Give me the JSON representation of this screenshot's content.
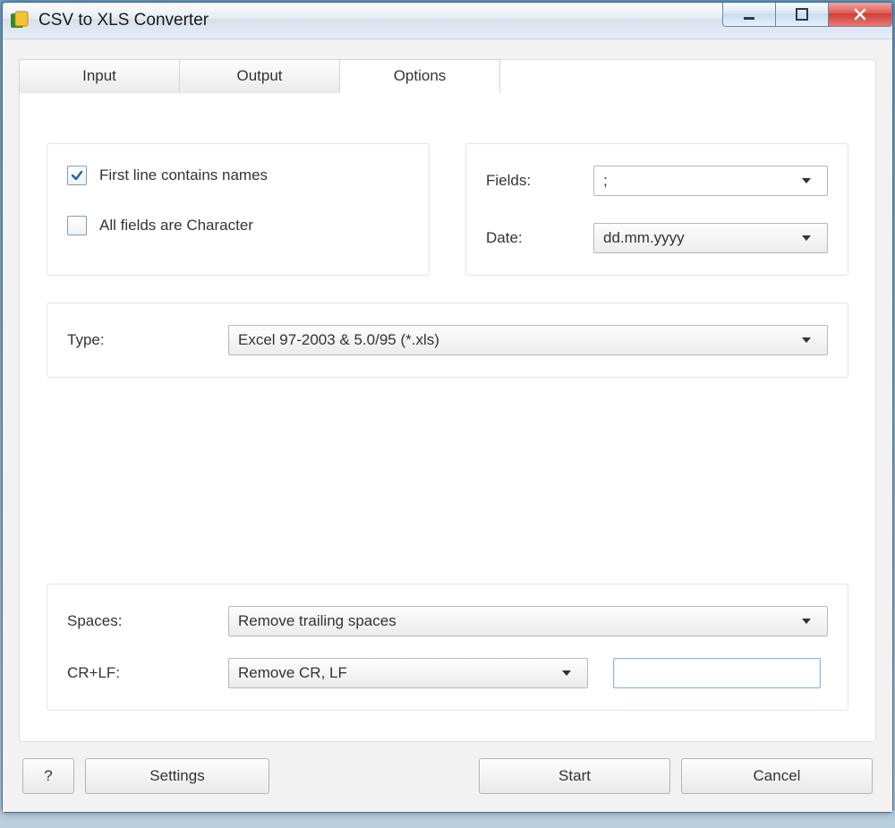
{
  "window": {
    "title": "CSV to XLS Converter"
  },
  "tabs": {
    "input": "Input",
    "output": "Output",
    "options": "Options"
  },
  "opts": {
    "first_line": "First line contains names",
    "all_char": "All fields are Character",
    "fields_label": "Fields:",
    "fields_value": ";",
    "date_label": "Date:",
    "date_value": "dd.mm.yyyy",
    "type_label": "Type:",
    "type_value": "Excel 97-2003 & 5.0/95 (*.xls)",
    "spaces_label": "Spaces:",
    "spaces_value": "Remove trailing spaces",
    "crlf_label": "CR+LF:",
    "crlf_value": "Remove CR, LF",
    "crlf_extra": ""
  },
  "footer": {
    "help": "?",
    "settings": "Settings",
    "start": "Start",
    "cancel": "Cancel"
  }
}
